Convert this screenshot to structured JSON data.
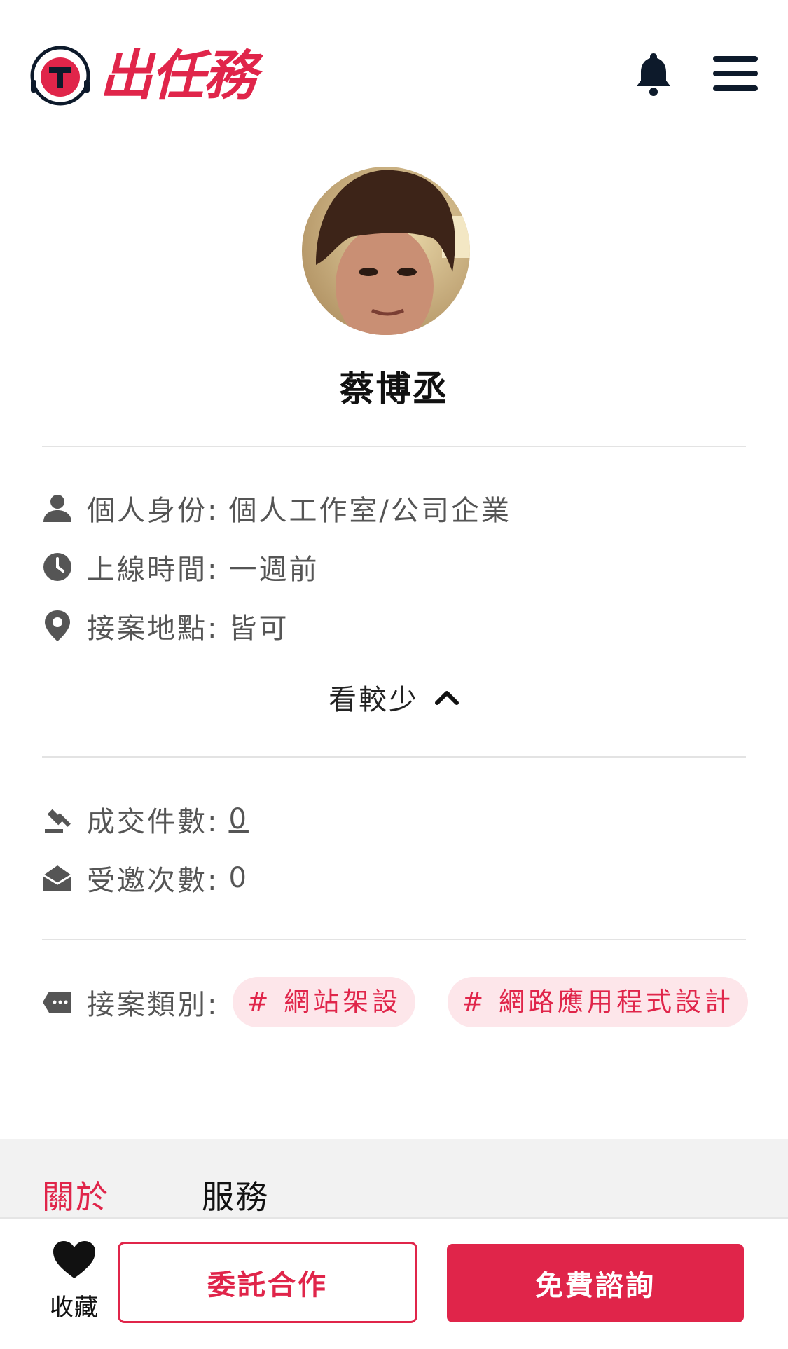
{
  "header": {
    "logo_text": "出任務",
    "logo_mark": "T"
  },
  "profile": {
    "name": "蔡博丞",
    "identity_label": "個人身份:",
    "identity_value": "個人工作室/公司企業",
    "online_label": "上線時間:",
    "online_value": "一週前",
    "location_label": "接案地點:",
    "location_value": "皆可",
    "toggle_label": "看較少"
  },
  "stats": {
    "deals_label": "成交件數:",
    "deals_value": "0",
    "invites_label": "受邀次數:",
    "invites_value": "0"
  },
  "categories": {
    "label": "接案類別:",
    "tags": [
      "#  網站架設",
      "#  網路應用程式設計"
    ]
  },
  "tabs": {
    "items": [
      "關於",
      "服務"
    ],
    "active_index": 0
  },
  "bottom_bar": {
    "favorite_label": "收藏",
    "commission_label": "委託合作",
    "consult_label": "免費諮詢"
  },
  "colors": {
    "brand": "#e0254a",
    "navy": "#0d1a2b",
    "tag_bg": "#fde6ea"
  },
  "icons": {
    "identity": "person-icon",
    "online": "clock-icon",
    "location": "pin-icon",
    "deals": "gavel-icon",
    "invites": "envelope-open-icon",
    "categories": "tag-icon"
  }
}
